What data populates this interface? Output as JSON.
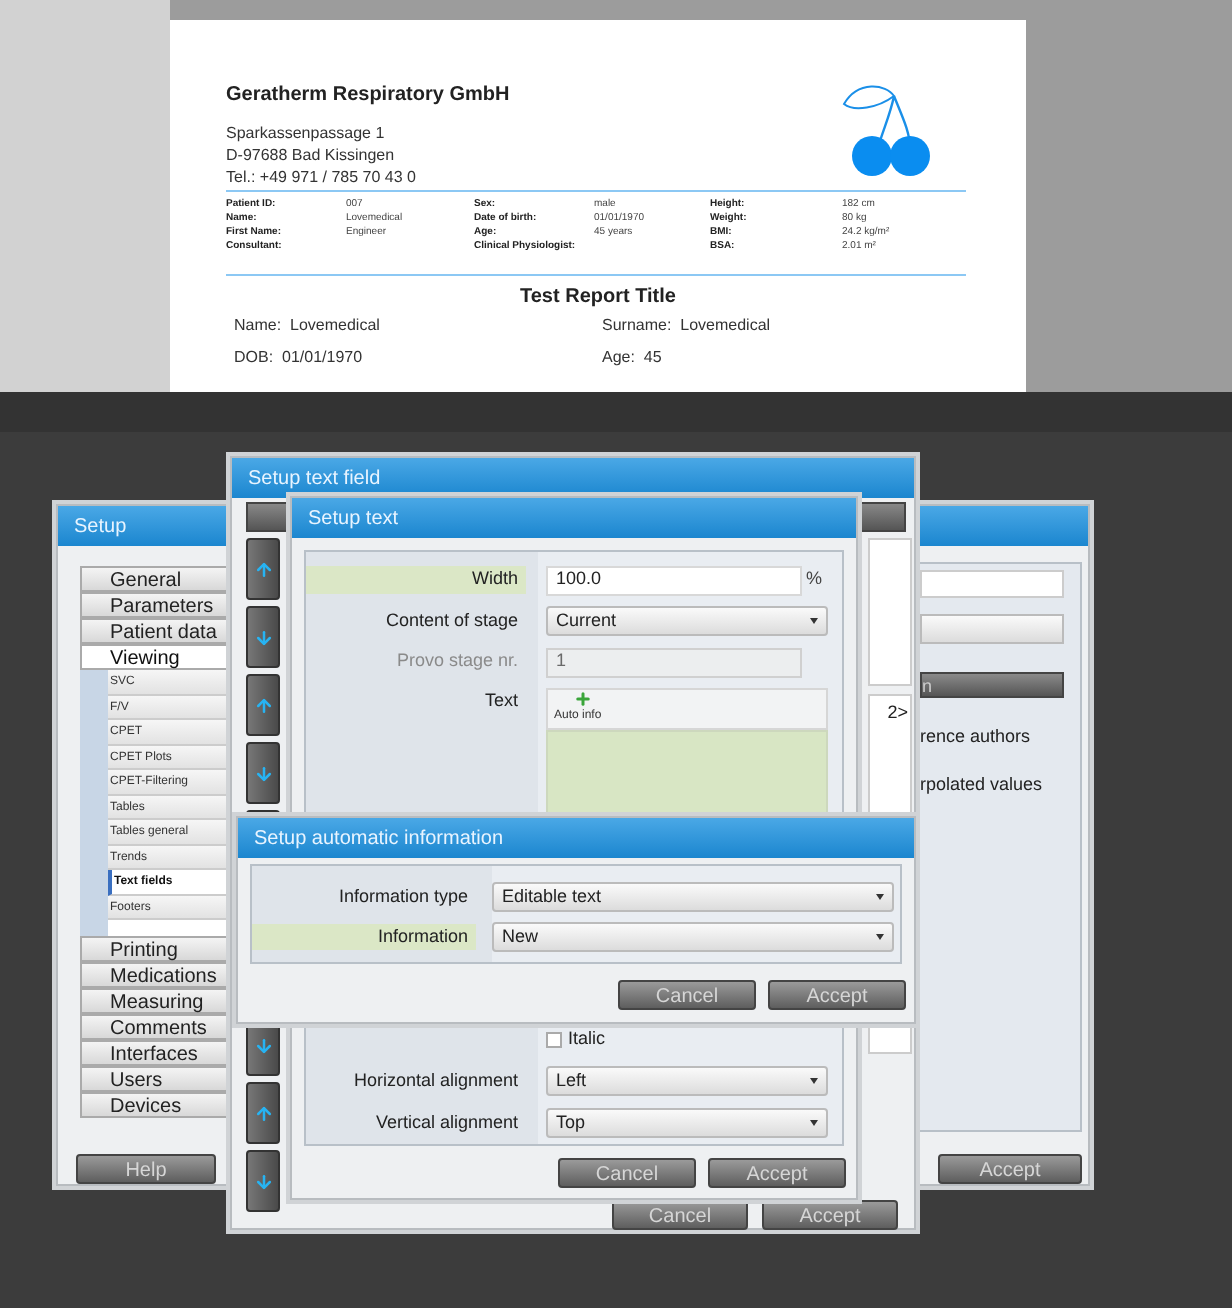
{
  "report": {
    "company": "Geratherm Respiratory GmbH",
    "address": [
      "Sparkassenpassage 1",
      "D-97688 Bad Kissingen",
      "Tel.: +49 971 / 785 70 43 0"
    ],
    "patient_table": [
      [
        {
          "label": "Patient ID:",
          "value": "007"
        },
        {
          "label": "Sex:",
          "value": "male"
        },
        {
          "label": "Height:",
          "value": "182 cm"
        }
      ],
      [
        {
          "label": "Name:",
          "value": "Lovemedical"
        },
        {
          "label": "Date of birth:",
          "value": "01/01/1970"
        },
        {
          "label": "Weight:",
          "value": "80 kg"
        }
      ],
      [
        {
          "label": "First Name:",
          "value": "Engineer"
        },
        {
          "label": "Age:",
          "value": "45 years"
        },
        {
          "label": "BMI:",
          "value": "24.2 kg/m²"
        }
      ],
      [
        {
          "label": "Consultant:"
        },
        {
          "label": "Clinical Physiologist:"
        },
        {
          "label": "BSA:",
          "value": "2.01 m²"
        }
      ]
    ],
    "title": "Test Report Title",
    "fields": [
      [
        {
          "label": "Name:",
          "value": "Lovemedical"
        },
        {
          "label": "Surname:",
          "value": "Lovemedical"
        }
      ],
      [
        {
          "label": "DOB:",
          "value": "01/01/1970"
        },
        {
          "label": "Age:",
          "value": "45"
        }
      ]
    ]
  },
  "setup": {
    "title": "Setup",
    "nav": [
      {
        "label": "General",
        "selected": false
      },
      {
        "label": "Parameters",
        "selected": false
      },
      {
        "label": "Patient data",
        "selected": false
      },
      {
        "label": "Viewing",
        "selected": true,
        "children": [
          {
            "label": "SVC",
            "selected": false
          },
          {
            "label": "F/V",
            "selected": false
          },
          {
            "label": "CPET",
            "selected": false
          },
          {
            "label": "CPET Plots",
            "selected": false
          },
          {
            "label": "CPET-Filtering",
            "selected": false
          },
          {
            "label": "Tables",
            "selected": false
          },
          {
            "label": "Tables general",
            "selected": false
          },
          {
            "label": "Trends",
            "selected": false
          },
          {
            "label": "Text fields",
            "selected": true
          },
          {
            "label": "Footers",
            "selected": false
          }
        ]
      },
      {
        "label": "Printing",
        "selected": false
      },
      {
        "label": "Medications",
        "selected": false
      },
      {
        "label": "Measuring",
        "selected": false
      },
      {
        "label": "Comments",
        "selected": false
      },
      {
        "label": "Interfaces",
        "selected": false
      },
      {
        "label": "Users",
        "selected": false
      },
      {
        "label": "Devices",
        "selected": false
      }
    ],
    "panel_button": "n",
    "panel_lines": [
      "rence authors",
      "rpolated values"
    ],
    "buttons": [
      "Help",
      "Accept"
    ]
  },
  "text_field_dialog": {
    "title": "Setup text field",
    "fragment": "2>",
    "buttons": [
      "Cancel",
      "Accept"
    ]
  },
  "text_dialog": {
    "title": "Setup text",
    "rows": [
      {
        "kind": "input",
        "label": "Width",
        "highlighted": true,
        "value": "100.0",
        "unit": "%",
        "disabled": false
      },
      {
        "kind": "select",
        "label": "Content of stage",
        "highlighted": false,
        "value": "Current"
      },
      {
        "kind": "input",
        "label": "Provo stage nr.",
        "highlighted": false,
        "value": "1",
        "disabled": true
      },
      {
        "kind": "text",
        "label": "Text",
        "highlighted": false,
        "button": "Auto info"
      },
      {
        "kind": "checkbox",
        "label": "Italic",
        "checked": false
      },
      {
        "kind": "select",
        "label": "Horizontal alignment",
        "highlighted": false,
        "value": "Left"
      },
      {
        "kind": "select",
        "label": "Vertical alignment",
        "highlighted": false,
        "value": "Top"
      }
    ],
    "buttons": [
      "Cancel",
      "Accept"
    ]
  },
  "auto_info_dialog": {
    "title": "Setup automatic information",
    "rows": [
      {
        "label": "Information type",
        "highlighted": false,
        "value": "Editable text"
      },
      {
        "label": "Information",
        "highlighted": true,
        "value": "New"
      }
    ],
    "buttons": [
      "Cancel",
      "Accept"
    ]
  }
}
